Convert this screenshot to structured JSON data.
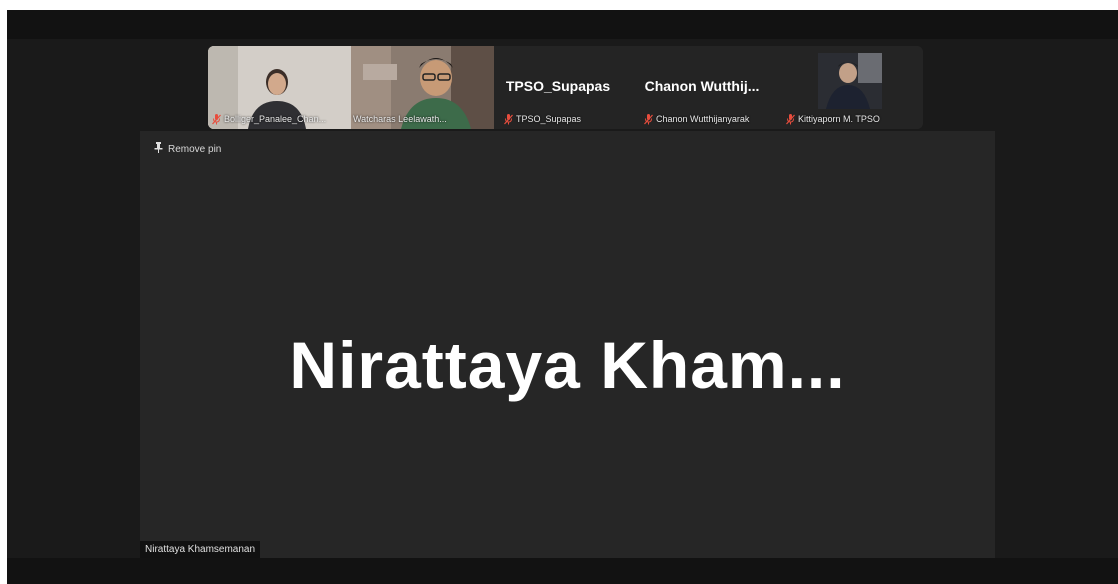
{
  "participants": [
    {
      "name": "Bolliger_Panalee_Chan...",
      "video": true,
      "muted": true
    },
    {
      "name": "Watcharas Leelawath...",
      "video": true,
      "muted": false
    },
    {
      "name": "TPSO_Supapas",
      "display": "TPSO_Supapas",
      "video": false,
      "muted": true
    },
    {
      "name": "Chanon Wutthijanyarak",
      "display": "Chanon Wutthij...",
      "video": false,
      "muted": true
    },
    {
      "name": "Kittiyaporn M. TPSO",
      "video": true,
      "muted": true
    }
  ],
  "stage": {
    "remove_pin_label": "Remove pin",
    "display_name": "Nirattaya Kham...",
    "label": "Nirattaya Khamsemanan"
  },
  "icons": {
    "pin": "pin-icon",
    "muted_mic": "muted-mic-icon"
  },
  "colors": {
    "background": "#1a1a1a",
    "stage": "#262626",
    "muted_red": "#e84d3d",
    "text": "#ffffff"
  }
}
